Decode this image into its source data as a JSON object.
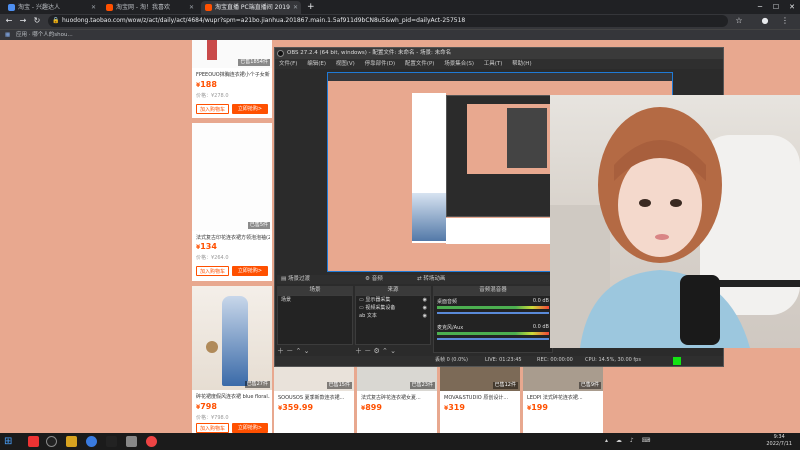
{
  "browser": {
    "tabs": [
      {
        "label": "淘宝 - 兴趣达人"
      },
      {
        "label": "淘宝网 - 淘！我喜欢"
      },
      {
        "label": "淘宝直播 PC端直播间 2019"
      }
    ],
    "new_tab": "+",
    "url": "huodong.taobao.com/wow/z/act/daily/act/4684/wupr?spm=a21bo.jianhua.201867.main.1.5af911d9bCN8u5&wh_pid=dailyAct-257518",
    "bookmark": "应用 · 哪个人的shou...",
    "controls": {
      "minimize": "─",
      "maximize": "☐",
      "close": "✕"
    }
  },
  "page": {
    "left_column": [
      {
        "badge": "已售1854件",
        "title": "FPEEOUO抹胸连衣裙小个子女新款...",
        "price": "188",
        "orig": "价格：¥278.0",
        "btn_buy": "加入购物车",
        "btn_go": "立即抢购>"
      },
      {
        "badge": "已售5件",
        "title": "法式复古印花连衣裙方领泡泡袖(20...",
        "price": "134",
        "orig": "价格：¥264.0",
        "btn_buy": "加入购物车",
        "btn_go": "立即抢购>"
      },
      {
        "badge": "已售27件",
        "title": "碎花裙度假风连衣裙 blue floral...",
        "price": "798",
        "orig": "价格：¥798.0",
        "btn_buy": "加入购物车",
        "btn_go": "立即抢购>"
      }
    ],
    "bottom_row": [
      {
        "badge": "已售15件",
        "title": "SOOUSOS 夏季新款连衣裙...",
        "price": "359.99"
      },
      {
        "badge": "已售23件",
        "title": "法式复古碎花连衣裙女夏...",
        "price": "899"
      },
      {
        "badge": "已售12件",
        "title": "MOVA&STUDIO 原创设计...",
        "price": "319"
      },
      {
        "badge": "已售9件",
        "title": "LEDPI 法式碎花连衣裙...",
        "price": "199"
      }
    ],
    "currency": "¥"
  },
  "obs": {
    "title": "OBS 27.2.4 (64 bit, windows) - 配置文件: 未命名 - 场景: 未命名",
    "menu": [
      "文件(F)",
      "编辑(E)",
      "视图(V)",
      "停靠部件(D)",
      "配置文件(P)",
      "场景集合(S)",
      "工具(T)",
      "帮助(H)"
    ],
    "docks": {
      "scenes": "场景",
      "sources": "来源",
      "mixer": "音频混音器",
      "transitions": "转场动画",
      "controls": "控制按钮",
      "tab_audio": "音频",
      "tab_scenes": "场景过渡"
    },
    "scene_items": [
      "场景"
    ],
    "source_items": [
      "显示器采集",
      "视频采集设备",
      "文本"
    ],
    "mixer_tracks": [
      {
        "name": "桌面音频",
        "value": "0.0 dB"
      },
      {
        "name": "麦克风/Aux",
        "value": "0.0 dB"
      }
    ],
    "status": {
      "drop": "丢帧 0 (0.0%)",
      "live": "LIVE: 01:23:45",
      "rec": "REC: 00:00:00",
      "cpu": "CPU: 14.5%, 30.00 fps"
    }
  },
  "taskbar": {
    "time": "9:34",
    "date": "2022/7/11"
  }
}
